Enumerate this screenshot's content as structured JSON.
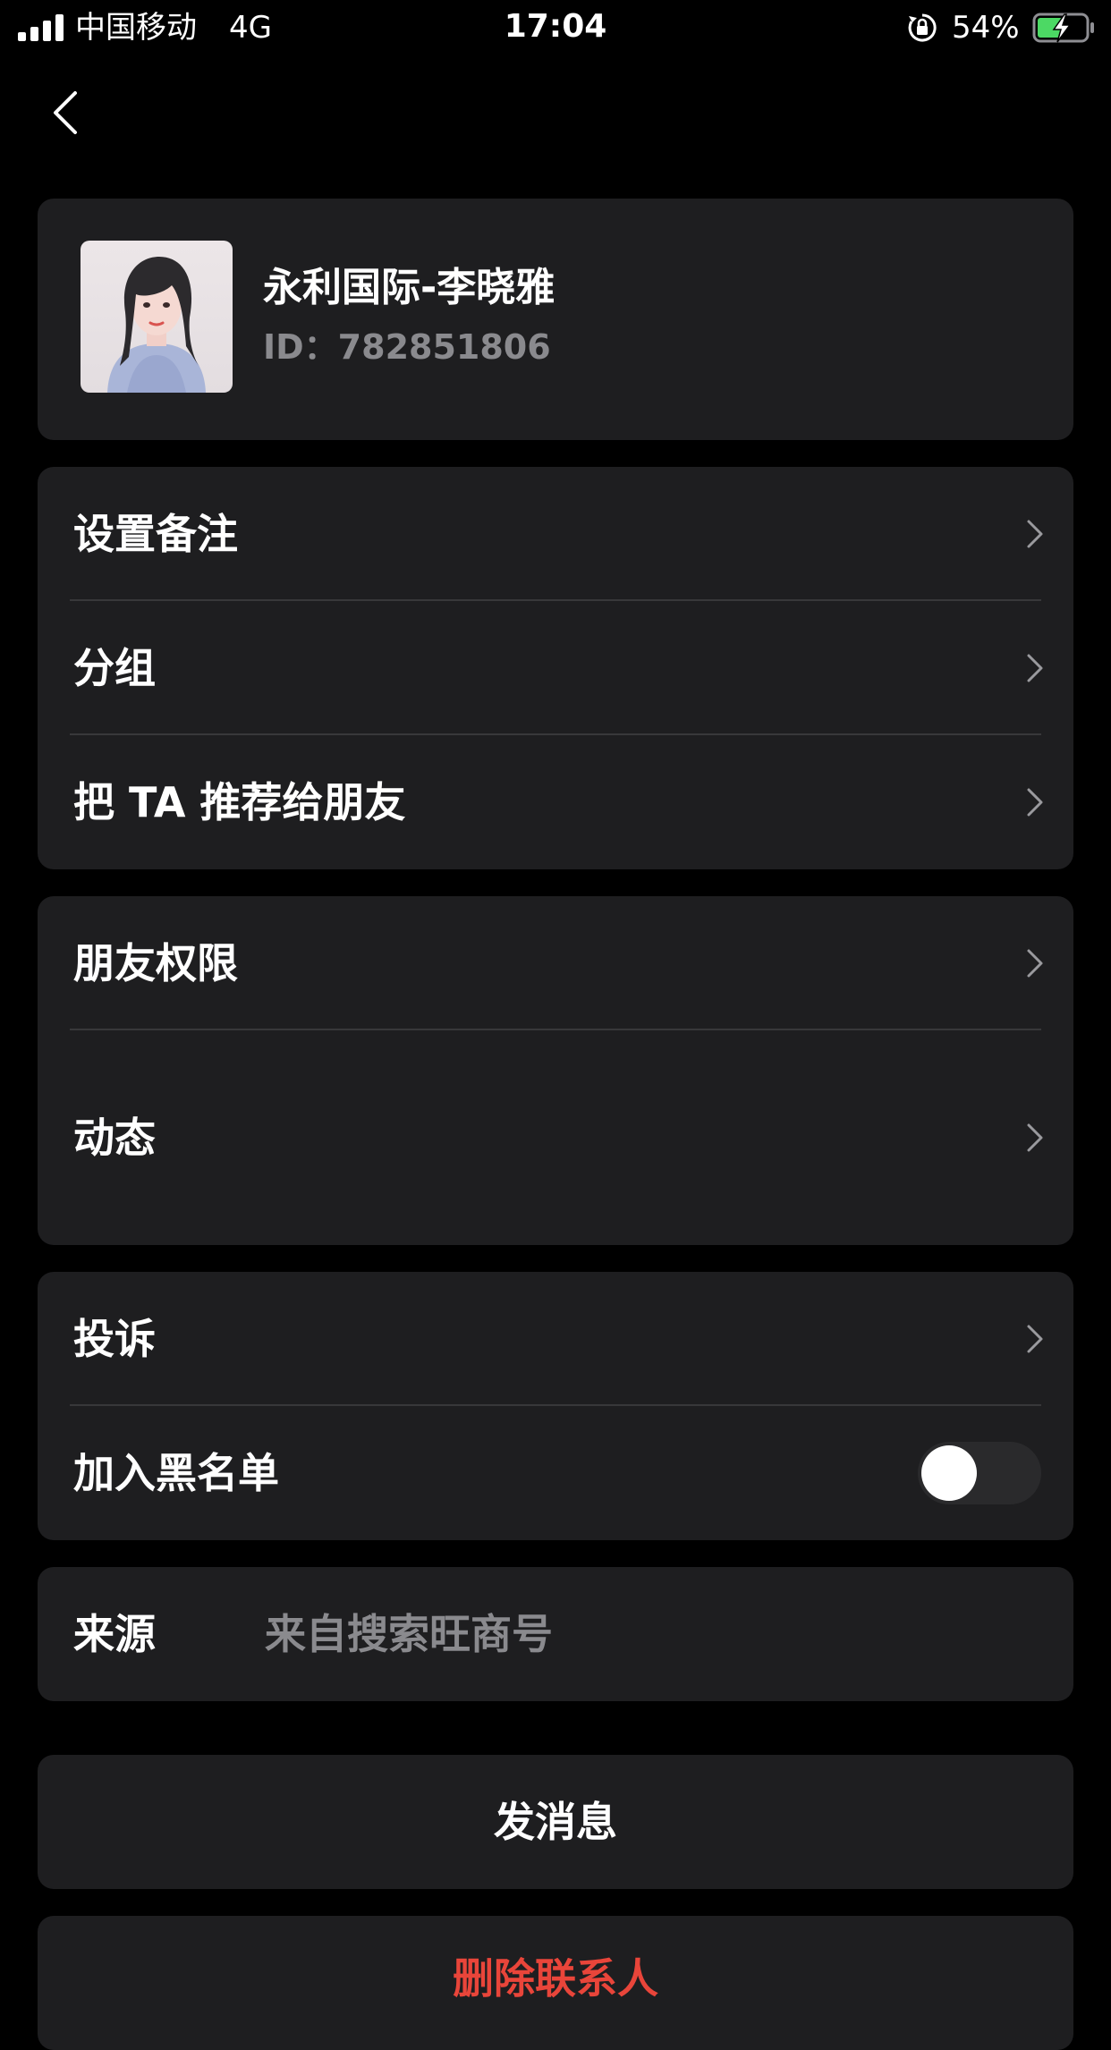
{
  "status_bar": {
    "carrier": "中国移动",
    "network": "4G",
    "time": "17:04",
    "battery_percent": "54%",
    "battery_level": 0.54,
    "charging": true,
    "icons": [
      "signal-icon",
      "rotation-lock-icon",
      "battery-charging-icon"
    ]
  },
  "nav": {
    "back_icon": "chevron-left-icon"
  },
  "profile": {
    "name": "永利国际-李晓雅",
    "id_text": "ID：782851806"
  },
  "groups": [
    {
      "items": [
        {
          "label": "设置备注",
          "icon": "chevron-right-icon"
        },
        {
          "label": "分组",
          "icon": "chevron-right-icon"
        },
        {
          "label": "把 TA 推荐给朋友",
          "icon": "chevron-right-icon"
        }
      ]
    },
    {
      "items": [
        {
          "label": "朋友权限",
          "icon": "chevron-right-icon"
        },
        {
          "label": "动态",
          "icon": "chevron-right-icon"
        }
      ]
    },
    {
      "items": [
        {
          "label": "投诉",
          "icon": "chevron-right-icon"
        },
        {
          "label": "加入黑名单",
          "toggle_on": false
        }
      ]
    }
  ],
  "source": {
    "label": "来源",
    "value": "来自搜索旺商号"
  },
  "actions": {
    "send_message": "发消息",
    "delete_contact": "删除联系人"
  },
  "colors": {
    "background": "#000000",
    "card": "#1e1e20",
    "secondary_text": "#8a8a8e",
    "danger": "#e9453a",
    "battery_green": "#4cd964"
  }
}
